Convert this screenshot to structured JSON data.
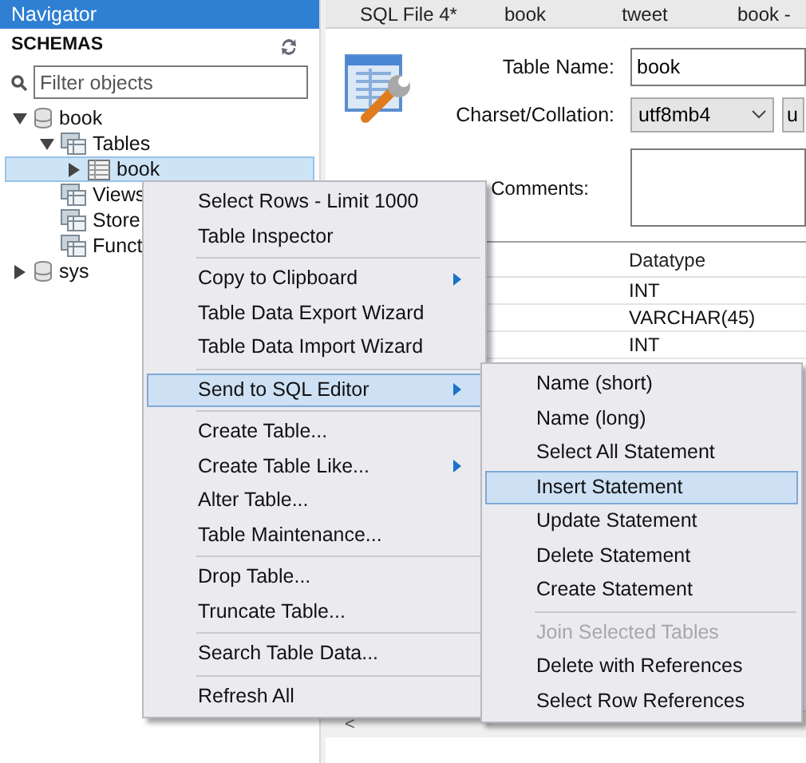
{
  "navigator": {
    "title": "Navigator",
    "section": "SCHEMAS",
    "filter": {
      "placeholder": "Filter objects"
    },
    "tree": [
      {
        "label": "book",
        "kind": "schema",
        "expanded": true,
        "selected": false,
        "children": [
          {
            "label": "Tables",
            "kind": "folder",
            "expanded": true,
            "selected": false,
            "children": [
              {
                "label": "book",
                "kind": "table",
                "expanded": false,
                "selected": true
              }
            ]
          },
          {
            "label": "Views",
            "kind": "folder",
            "selected": false
          },
          {
            "label": "Store",
            "kind": "folder",
            "selected": false
          },
          {
            "label": "Funct",
            "kind": "folder",
            "selected": false
          }
        ]
      },
      {
        "label": "sys",
        "kind": "schema",
        "expanded": false,
        "selected": false
      }
    ]
  },
  "tabs": [
    "SQL File 4*",
    "book",
    "tweet",
    "book -"
  ],
  "table_form": {
    "table_name_label": "Table Name:",
    "table_name": "book",
    "charset_label": "Charset/Collation:",
    "charset": "utf8mb4",
    "collation": "u",
    "comments_label": "Comments:"
  },
  "columns_grid": {
    "header": "Datatype",
    "rows": [
      "INT",
      "VARCHAR(45)",
      "INT"
    ],
    "scroll_left": "<"
  },
  "context_menu": [
    {
      "kind": "item",
      "label": "Select Rows - Limit 1000",
      "submenu": false,
      "selected": false
    },
    {
      "kind": "item",
      "label": "Table Inspector",
      "submenu": false,
      "selected": false
    },
    {
      "kind": "separator"
    },
    {
      "kind": "item",
      "label": "Copy to Clipboard",
      "submenu": true,
      "selected": false
    },
    {
      "kind": "item",
      "label": "Table Data Export Wizard",
      "submenu": false,
      "selected": false
    },
    {
      "kind": "item",
      "label": "Table Data Import Wizard",
      "submenu": false,
      "selected": false
    },
    {
      "kind": "separator"
    },
    {
      "kind": "item",
      "label": "Send to SQL Editor",
      "submenu": true,
      "selected": true
    },
    {
      "kind": "separator"
    },
    {
      "kind": "item",
      "label": "Create Table...",
      "submenu": false,
      "selected": false
    },
    {
      "kind": "item",
      "label": "Create Table Like...",
      "submenu": true,
      "selected": false
    },
    {
      "kind": "item",
      "label": "Alter Table...",
      "submenu": false,
      "selected": false
    },
    {
      "kind": "item",
      "label": "Table Maintenance...",
      "submenu": false,
      "selected": false
    },
    {
      "kind": "separator"
    },
    {
      "kind": "item",
      "label": "Drop Table...",
      "submenu": false,
      "selected": false
    },
    {
      "kind": "item",
      "label": "Truncate Table...",
      "submenu": false,
      "selected": false
    },
    {
      "kind": "separator"
    },
    {
      "kind": "item",
      "label": "Search Table Data...",
      "submenu": false,
      "selected": false
    },
    {
      "kind": "separator"
    },
    {
      "kind": "item",
      "label": "Refresh All",
      "submenu": false,
      "selected": false
    }
  ],
  "submenu": [
    {
      "kind": "item",
      "label": "Name (short)",
      "selected": false,
      "disabled": false
    },
    {
      "kind": "item",
      "label": "Name (long)",
      "selected": false,
      "disabled": false
    },
    {
      "kind": "item",
      "label": "Select All Statement",
      "selected": false,
      "disabled": false
    },
    {
      "kind": "item",
      "label": "Insert Statement",
      "selected": true,
      "disabled": false
    },
    {
      "kind": "item",
      "label": "Update Statement",
      "selected": false,
      "disabled": false
    },
    {
      "kind": "item",
      "label": "Delete Statement",
      "selected": false,
      "disabled": false
    },
    {
      "kind": "item",
      "label": "Create Statement",
      "selected": false,
      "disabled": false
    },
    {
      "kind": "separator"
    },
    {
      "kind": "item",
      "label": "Join Selected Tables",
      "selected": false,
      "disabled": true
    },
    {
      "kind": "item",
      "label": "Delete with References",
      "selected": false,
      "disabled": false
    },
    {
      "kind": "item",
      "label": "Select Row References",
      "selected": false,
      "disabled": false
    }
  ]
}
